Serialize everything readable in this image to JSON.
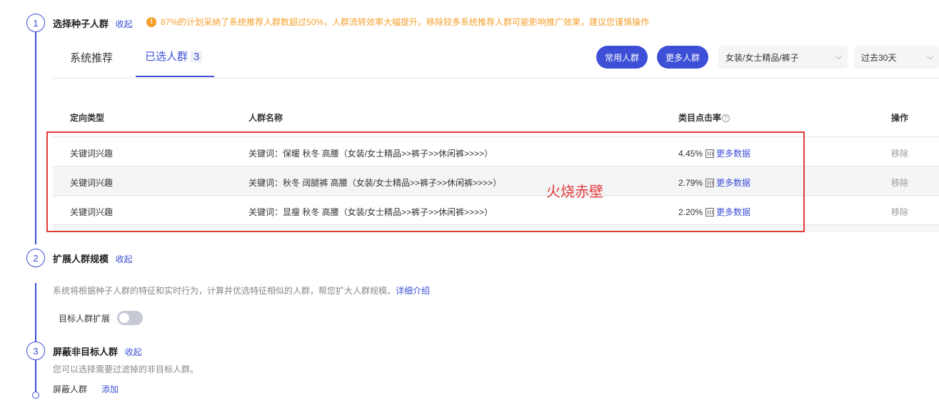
{
  "step1": {
    "number": "1",
    "title": "选择种子人群",
    "collapse": "收起",
    "warning": "87%的计划采纳了系统推荐人群数超过50%，人群流转效率大幅提升。移除较多系统推荐人群可能影响推广效果，建议您谨慎操作",
    "tabs": [
      {
        "label": "系统推荐"
      },
      {
        "label": "已选人群",
        "count": "3"
      }
    ],
    "buttons": {
      "common": "常用人群",
      "more": "更多人群"
    },
    "category_select": "女装/女士精品/裤子",
    "time_select": "过去30天",
    "table": {
      "headers": {
        "type": "定向类型",
        "name": "人群名称",
        "ctr": "类目点击率",
        "ops": "操作"
      },
      "rows": [
        {
          "type": "关键词兴趣",
          "name": "关键词：保暖 秋冬 高腰（女装/女士精品>>裤子>>休闲裤>>>>）",
          "ctr": "4.45%",
          "more": "更多数据",
          "remove": "移除"
        },
        {
          "type": "关键词兴趣",
          "name": "关键词：秋冬 阔腿裤 高腰（女装/女士精品>>裤子>>休闲裤>>>>）",
          "ctr": "2.79%",
          "more": "更多数据",
          "remove": "移除"
        },
        {
          "type": "关键词兴趣",
          "name": "关键词：显瘦 秋冬 高腰（女装/女士精品>>裤子>>休闲裤>>>>）",
          "ctr": "2.20%",
          "more": "更多数据",
          "remove": "移除"
        }
      ]
    },
    "watermark": "火烧赤壁"
  },
  "step2": {
    "number": "2",
    "title": "扩展人群规模",
    "collapse": "收起",
    "description": "系统将根据种子人群的特征和实时行为，计算并优选特征相似的人群，帮您扩大人群规模。",
    "detail_link": "详细介绍",
    "toggle_label": "目标人群扩展"
  },
  "step3": {
    "number": "3",
    "title": "屏蔽非目标人群",
    "collapse": "收起",
    "description": "您可以选择需要过滤掉的非目标人群。",
    "field_label": "屏蔽人群",
    "add": "添加"
  },
  "colors": {
    "accent": "#3d4fd6",
    "warning": "#f5a02c",
    "highlight": "#e33a3a"
  }
}
